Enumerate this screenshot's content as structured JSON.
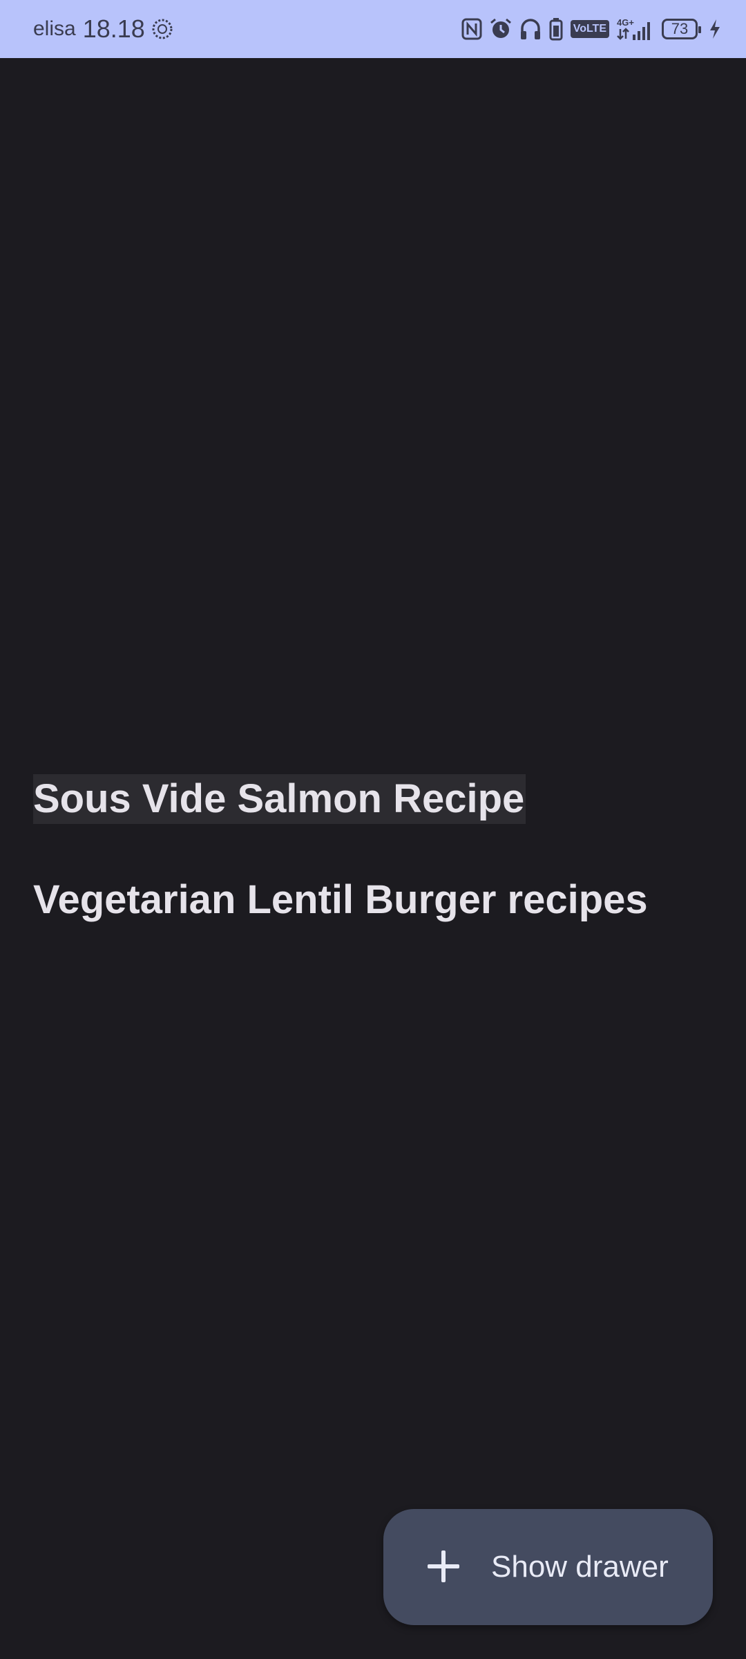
{
  "status_bar": {
    "carrier": "elisa",
    "time": "18.18",
    "battery_level": "73",
    "network": "4G+",
    "volte_label": "VoLTE",
    "background_color": "#b8c3fb",
    "icons": [
      "data-saver-icon",
      "nfc-icon",
      "alarm-icon",
      "headphones-icon",
      "battery-saver-icon",
      "volte-icon",
      "signal-icon",
      "battery-icon",
      "charging-icon"
    ]
  },
  "recipes": {
    "items": [
      {
        "label": "Sous Vide Salmon Recipe",
        "selected": true
      },
      {
        "label": "Vegetarian Lentil Burger recipes",
        "selected": false
      }
    ]
  },
  "fab": {
    "icon": "plus-icon",
    "label": "Show drawer",
    "background_color": "#444b60"
  },
  "theme": {
    "background": "#1c1b20",
    "text": "#e6e3ea"
  }
}
